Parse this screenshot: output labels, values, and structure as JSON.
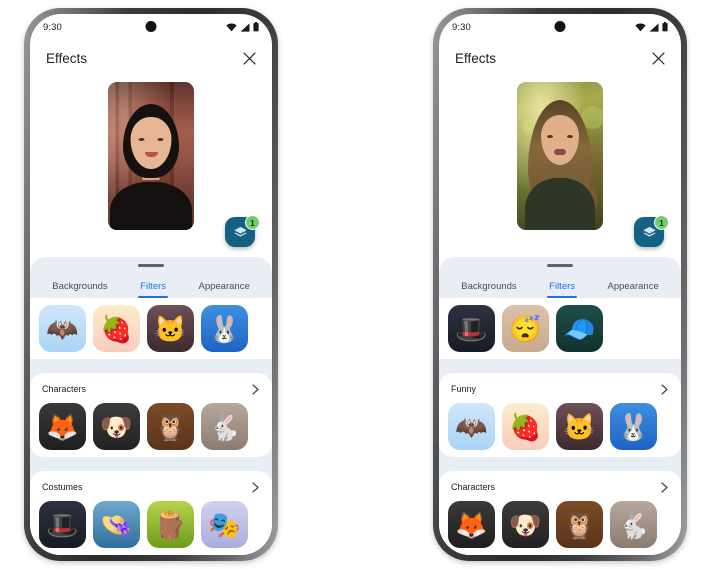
{
  "accent_color": "#1a73e8",
  "fab_color": "#156184",
  "badge_color": "#6fce6f",
  "sheet_bg": "#e9eef5",
  "phones": [
    {
      "name": "phone-left",
      "status": {
        "time": "9:30",
        "icons": [
          "wifi-icon",
          "cell-signal-icon",
          "battery-icon"
        ]
      },
      "appbar": {
        "title": "Effects",
        "close_label": "✕"
      },
      "preview": {
        "description": "self-view-video"
      },
      "fab": {
        "icon": "layers-icon",
        "badge_count": "1"
      },
      "sheet": {
        "grabber": "drag-handle",
        "tabs": [
          {
            "label": "Backgrounds",
            "active": false
          },
          {
            "label": "Filters",
            "active": true
          },
          {
            "label": "Appearance",
            "active": false
          }
        ],
        "top_row": [
          {
            "name": "bat",
            "glyph": "🦇",
            "art": "a-bat"
          },
          {
            "name": "strawberry",
            "glyph": "🍓",
            "art": "a-strawberry"
          },
          {
            "name": "black-cat",
            "glyph": "🐱",
            "art": "a-cat"
          },
          {
            "name": "bunny",
            "glyph": "🐰",
            "art": "a-bunny"
          }
        ],
        "sections": [
          {
            "label": "Characters",
            "chevron": "chevron-right-icon",
            "items": [
              {
                "name": "fox",
                "glyph": "🦊",
                "art": "a-fox"
              },
              {
                "name": "dog",
                "glyph": "🐶",
                "art": "a-dog"
              },
              {
                "name": "owl",
                "glyph": "🦉",
                "art": "a-owl"
              },
              {
                "name": "rabbit",
                "glyph": "🐇",
                "art": "a-rabbit"
              }
            ]
          },
          {
            "label": "Costumes",
            "chevron": "chevron-right-icon",
            "items": [
              {
                "name": "black-hat",
                "glyph": "🎩",
                "art": "a-hat"
              },
              {
                "name": "brown-fedora",
                "glyph": "👒",
                "art": "a-fedora"
              },
              {
                "name": "wood-log",
                "glyph": "🪵",
                "art": "a-log"
              },
              {
                "name": "carnival-mask",
                "glyph": "🎭",
                "art": "a-mask"
              }
            ]
          }
        ]
      }
    },
    {
      "name": "phone-right",
      "status": {
        "time": "9:30",
        "icons": [
          "wifi-icon",
          "cell-signal-icon",
          "battery-icon"
        ]
      },
      "appbar": {
        "title": "Effects",
        "close_label": "✕"
      },
      "preview": {
        "description": "self-view-video"
      },
      "fab": {
        "icon": "layers-icon",
        "badge_count": "1"
      },
      "sheet": {
        "grabber": "drag-handle",
        "tabs": [
          {
            "label": "Backgrounds",
            "active": false
          },
          {
            "label": "Filters",
            "active": true
          },
          {
            "label": "Appearance",
            "active": false
          }
        ],
        "top_row": [
          {
            "name": "black-hat",
            "glyph": "🎩",
            "art": "a-hat"
          },
          {
            "name": "sleepy-glasses-face",
            "glyph": "😴",
            "art": "a-glasses"
          },
          {
            "name": "blue-beanie",
            "glyph": "🧢",
            "art": "a-beanie"
          }
        ],
        "sections": [
          {
            "label": "Funny",
            "chevron": "chevron-right-icon",
            "items": [
              {
                "name": "bat",
                "glyph": "🦇",
                "art": "a-bat"
              },
              {
                "name": "strawberry",
                "glyph": "🍓",
                "art": "a-strawberry"
              },
              {
                "name": "black-cat",
                "glyph": "🐱",
                "art": "a-cat"
              },
              {
                "name": "bunny",
                "glyph": "🐰",
                "art": "a-bunny"
              }
            ]
          },
          {
            "label": "Characters",
            "chevron": "chevron-right-icon",
            "items": [
              {
                "name": "fox",
                "glyph": "🦊",
                "art": "a-fox"
              },
              {
                "name": "dog",
                "glyph": "🐶",
                "art": "a-dog"
              },
              {
                "name": "owl",
                "glyph": "🦉",
                "art": "a-owl"
              },
              {
                "name": "rabbit",
                "glyph": "🐇",
                "art": "a-rabbit"
              }
            ]
          }
        ]
      }
    }
  ]
}
